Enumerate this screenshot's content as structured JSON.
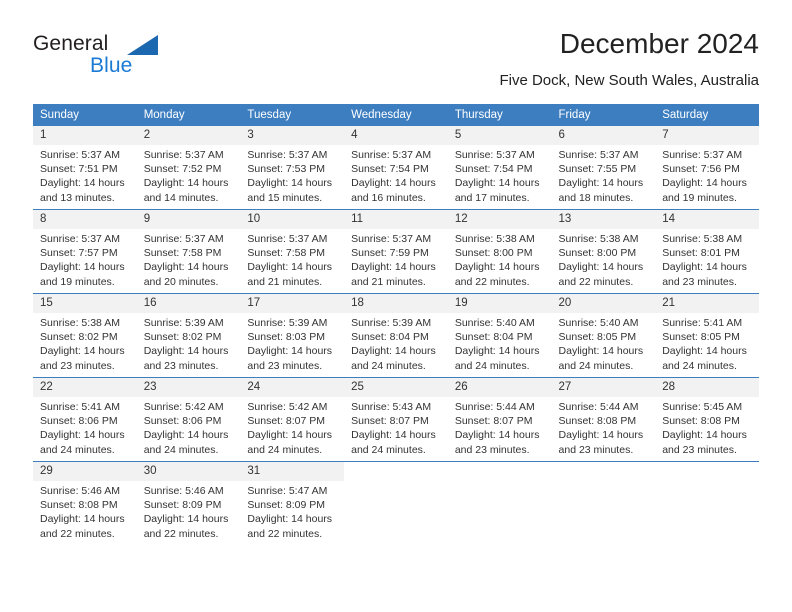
{
  "brand": {
    "name_dark": "General",
    "name_blue": "Blue",
    "accent_blue": "#1b7bd4",
    "triangle_blue": "#1b68b1"
  },
  "header": {
    "title": "December 2024",
    "subtitle": "Five Dock, New South Wales, Australia"
  },
  "calendar": {
    "header_color": "#3d7ec1",
    "daynum_bg": "#f2f2f2",
    "weekday_headers": [
      "Sunday",
      "Monday",
      "Tuesday",
      "Wednesday",
      "Thursday",
      "Friday",
      "Saturday"
    ],
    "weeks": [
      [
        {
          "day": "1",
          "sunrise": "Sunrise: 5:37 AM",
          "sunset": "Sunset: 7:51 PM",
          "daylight1": "Daylight: 14 hours",
          "daylight2": "and 13 minutes."
        },
        {
          "day": "2",
          "sunrise": "Sunrise: 5:37 AM",
          "sunset": "Sunset: 7:52 PM",
          "daylight1": "Daylight: 14 hours",
          "daylight2": "and 14 minutes."
        },
        {
          "day": "3",
          "sunrise": "Sunrise: 5:37 AM",
          "sunset": "Sunset: 7:53 PM",
          "daylight1": "Daylight: 14 hours",
          "daylight2": "and 15 minutes."
        },
        {
          "day": "4",
          "sunrise": "Sunrise: 5:37 AM",
          "sunset": "Sunset: 7:54 PM",
          "daylight1": "Daylight: 14 hours",
          "daylight2": "and 16 minutes."
        },
        {
          "day": "5",
          "sunrise": "Sunrise: 5:37 AM",
          "sunset": "Sunset: 7:54 PM",
          "daylight1": "Daylight: 14 hours",
          "daylight2": "and 17 minutes."
        },
        {
          "day": "6",
          "sunrise": "Sunrise: 5:37 AM",
          "sunset": "Sunset: 7:55 PM",
          "daylight1": "Daylight: 14 hours",
          "daylight2": "and 18 minutes."
        },
        {
          "day": "7",
          "sunrise": "Sunrise: 5:37 AM",
          "sunset": "Sunset: 7:56 PM",
          "daylight1": "Daylight: 14 hours",
          "daylight2": "and 19 minutes."
        }
      ],
      [
        {
          "day": "8",
          "sunrise": "Sunrise: 5:37 AM",
          "sunset": "Sunset: 7:57 PM",
          "daylight1": "Daylight: 14 hours",
          "daylight2": "and 19 minutes."
        },
        {
          "day": "9",
          "sunrise": "Sunrise: 5:37 AM",
          "sunset": "Sunset: 7:58 PM",
          "daylight1": "Daylight: 14 hours",
          "daylight2": "and 20 minutes."
        },
        {
          "day": "10",
          "sunrise": "Sunrise: 5:37 AM",
          "sunset": "Sunset: 7:58 PM",
          "daylight1": "Daylight: 14 hours",
          "daylight2": "and 21 minutes."
        },
        {
          "day": "11",
          "sunrise": "Sunrise: 5:37 AM",
          "sunset": "Sunset: 7:59 PM",
          "daylight1": "Daylight: 14 hours",
          "daylight2": "and 21 minutes."
        },
        {
          "day": "12",
          "sunrise": "Sunrise: 5:38 AM",
          "sunset": "Sunset: 8:00 PM",
          "daylight1": "Daylight: 14 hours",
          "daylight2": "and 22 minutes."
        },
        {
          "day": "13",
          "sunrise": "Sunrise: 5:38 AM",
          "sunset": "Sunset: 8:00 PM",
          "daylight1": "Daylight: 14 hours",
          "daylight2": "and 22 minutes."
        },
        {
          "day": "14",
          "sunrise": "Sunrise: 5:38 AM",
          "sunset": "Sunset: 8:01 PM",
          "daylight1": "Daylight: 14 hours",
          "daylight2": "and 23 minutes."
        }
      ],
      [
        {
          "day": "15",
          "sunrise": "Sunrise: 5:38 AM",
          "sunset": "Sunset: 8:02 PM",
          "daylight1": "Daylight: 14 hours",
          "daylight2": "and 23 minutes."
        },
        {
          "day": "16",
          "sunrise": "Sunrise: 5:39 AM",
          "sunset": "Sunset: 8:02 PM",
          "daylight1": "Daylight: 14 hours",
          "daylight2": "and 23 minutes."
        },
        {
          "day": "17",
          "sunrise": "Sunrise: 5:39 AM",
          "sunset": "Sunset: 8:03 PM",
          "daylight1": "Daylight: 14 hours",
          "daylight2": "and 23 minutes."
        },
        {
          "day": "18",
          "sunrise": "Sunrise: 5:39 AM",
          "sunset": "Sunset: 8:04 PM",
          "daylight1": "Daylight: 14 hours",
          "daylight2": "and 24 minutes."
        },
        {
          "day": "19",
          "sunrise": "Sunrise: 5:40 AM",
          "sunset": "Sunset: 8:04 PM",
          "daylight1": "Daylight: 14 hours",
          "daylight2": "and 24 minutes."
        },
        {
          "day": "20",
          "sunrise": "Sunrise: 5:40 AM",
          "sunset": "Sunset: 8:05 PM",
          "daylight1": "Daylight: 14 hours",
          "daylight2": "and 24 minutes."
        },
        {
          "day": "21",
          "sunrise": "Sunrise: 5:41 AM",
          "sunset": "Sunset: 8:05 PM",
          "daylight1": "Daylight: 14 hours",
          "daylight2": "and 24 minutes."
        }
      ],
      [
        {
          "day": "22",
          "sunrise": "Sunrise: 5:41 AM",
          "sunset": "Sunset: 8:06 PM",
          "daylight1": "Daylight: 14 hours",
          "daylight2": "and 24 minutes."
        },
        {
          "day": "23",
          "sunrise": "Sunrise: 5:42 AM",
          "sunset": "Sunset: 8:06 PM",
          "daylight1": "Daylight: 14 hours",
          "daylight2": "and 24 minutes."
        },
        {
          "day": "24",
          "sunrise": "Sunrise: 5:42 AM",
          "sunset": "Sunset: 8:07 PM",
          "daylight1": "Daylight: 14 hours",
          "daylight2": "and 24 minutes."
        },
        {
          "day": "25",
          "sunrise": "Sunrise: 5:43 AM",
          "sunset": "Sunset: 8:07 PM",
          "daylight1": "Daylight: 14 hours",
          "daylight2": "and 24 minutes."
        },
        {
          "day": "26",
          "sunrise": "Sunrise: 5:44 AM",
          "sunset": "Sunset: 8:07 PM",
          "daylight1": "Daylight: 14 hours",
          "daylight2": "and 23 minutes."
        },
        {
          "day": "27",
          "sunrise": "Sunrise: 5:44 AM",
          "sunset": "Sunset: 8:08 PM",
          "daylight1": "Daylight: 14 hours",
          "daylight2": "and 23 minutes."
        },
        {
          "day": "28",
          "sunrise": "Sunrise: 5:45 AM",
          "sunset": "Sunset: 8:08 PM",
          "daylight1": "Daylight: 14 hours",
          "daylight2": "and 23 minutes."
        }
      ],
      [
        {
          "day": "29",
          "sunrise": "Sunrise: 5:46 AM",
          "sunset": "Sunset: 8:08 PM",
          "daylight1": "Daylight: 14 hours",
          "daylight2": "and 22 minutes."
        },
        {
          "day": "30",
          "sunrise": "Sunrise: 5:46 AM",
          "sunset": "Sunset: 8:09 PM",
          "daylight1": "Daylight: 14 hours",
          "daylight2": "and 22 minutes."
        },
        {
          "day": "31",
          "sunrise": "Sunrise: 5:47 AM",
          "sunset": "Sunset: 8:09 PM",
          "daylight1": "Daylight: 14 hours",
          "daylight2": "and 22 minutes."
        },
        {
          "day": "",
          "sunrise": "",
          "sunset": "",
          "daylight1": "",
          "daylight2": ""
        },
        {
          "day": "",
          "sunrise": "",
          "sunset": "",
          "daylight1": "",
          "daylight2": ""
        },
        {
          "day": "",
          "sunrise": "",
          "sunset": "",
          "daylight1": "",
          "daylight2": ""
        },
        {
          "day": "",
          "sunrise": "",
          "sunset": "",
          "daylight1": "",
          "daylight2": ""
        }
      ]
    ]
  }
}
